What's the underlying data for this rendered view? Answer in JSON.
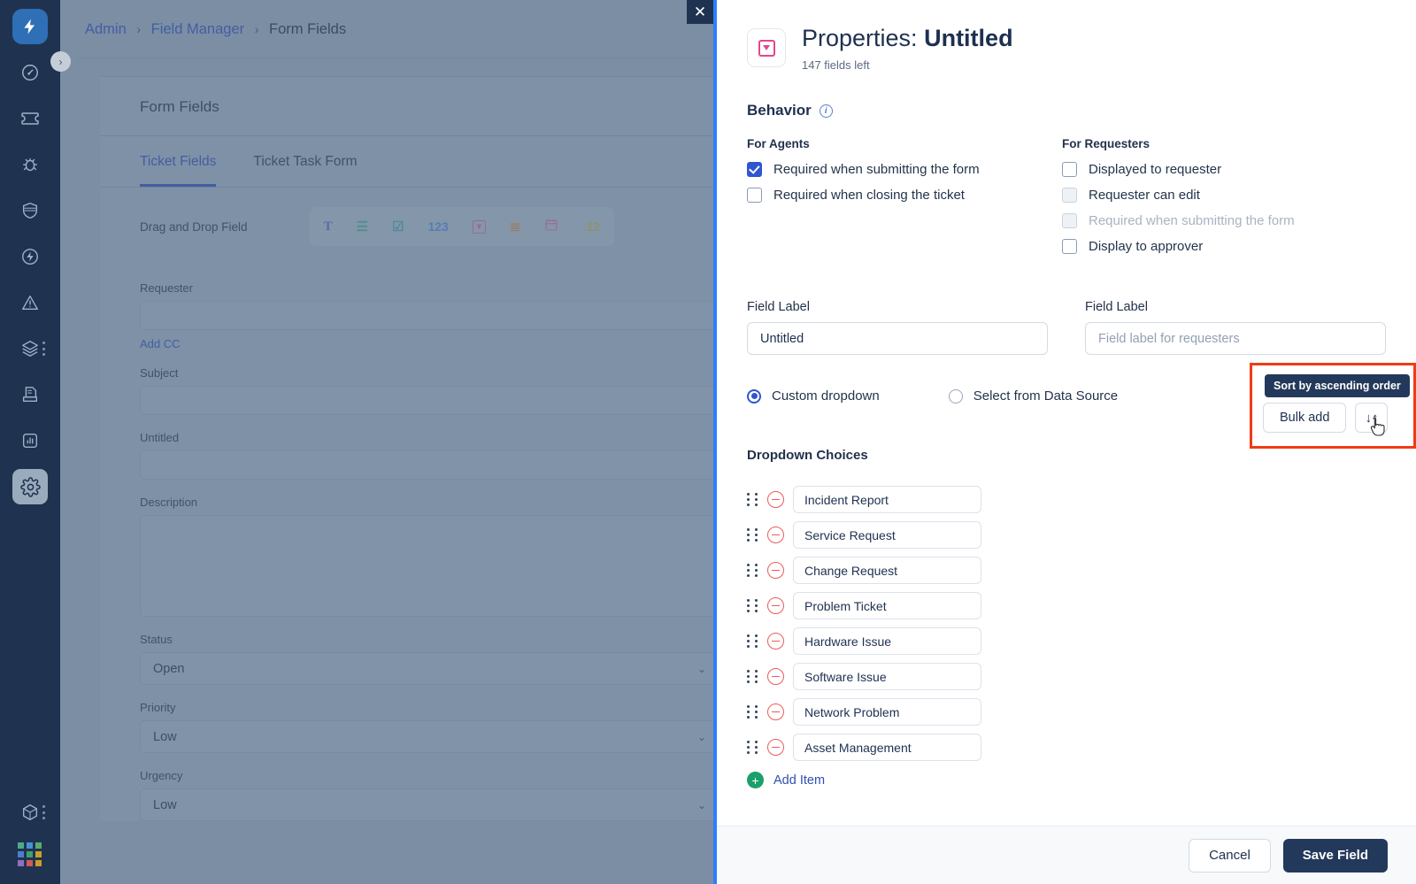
{
  "sidebar": {
    "logo": "lightning-logo",
    "items": [
      {
        "icon": "gauge-icon",
        "name": "dashboard"
      },
      {
        "icon": "ticket-icon",
        "name": "tickets"
      },
      {
        "icon": "bug-icon",
        "name": "problems"
      },
      {
        "icon": "shield-icon",
        "name": "changes"
      },
      {
        "icon": "lightning-circle-icon",
        "name": "releases"
      },
      {
        "icon": "alert-triangle-icon",
        "name": "incidents"
      },
      {
        "icon": "layers-icon",
        "name": "assets"
      },
      {
        "icon": "document-tray-icon",
        "name": "knowledge"
      },
      {
        "icon": "chart-icon",
        "name": "analytics"
      },
      {
        "icon": "gear-icon",
        "name": "admin"
      }
    ],
    "bottom_items": [
      {
        "icon": "cube-icon",
        "name": "marketplace"
      },
      {
        "icon": "apps-grid-icon",
        "name": "apps"
      }
    ],
    "expand_toggle": "›"
  },
  "background": {
    "breadcrumb": {
      "admin": "Admin",
      "field_manager": "Field Manager",
      "current": "Form Fields",
      "separator": "›"
    },
    "card_title": "Form Fields",
    "tabs": [
      {
        "label": "Ticket Fields",
        "active": true
      },
      {
        "label": "Ticket Task Form",
        "active": false
      }
    ],
    "drag_drop_label": "Drag and Drop Field",
    "field_types": [
      {
        "glyph": "T",
        "name": "text-field-icon",
        "color": "#2f4fb0"
      },
      {
        "glyph": "☰",
        "name": "paragraph-field-icon",
        "color": "#2c9e7a"
      },
      {
        "glyph": "☑",
        "name": "checkbox-field-icon",
        "color": "#2a8f9e"
      },
      {
        "glyph": "123",
        "name": "number-field-icon",
        "color": "#3570d4"
      },
      {
        "glyph": "▾",
        "name": "dropdown-field-icon",
        "color": "#d4458a"
      },
      {
        "glyph": "≣",
        "name": "multiselect-field-icon",
        "color": "#d4762a"
      },
      {
        "glyph": "Ὄ5",
        "name": "date-field-icon",
        "color": "#d4458a"
      },
      {
        "glyph": ".12",
        "name": "decimal-field-icon",
        "color": "#c6a02a"
      }
    ],
    "fields": [
      {
        "label": "Requester",
        "type": "input",
        "value": ""
      },
      {
        "label": "Subject",
        "type": "input",
        "value": ""
      },
      {
        "label": "Untitled",
        "type": "input",
        "value": ""
      },
      {
        "label": "Description",
        "type": "textarea",
        "value": ""
      }
    ],
    "add_cc": "Add CC",
    "selects": [
      {
        "label": "Status",
        "value": "Open"
      },
      {
        "label": "Priority",
        "value": "Low"
      },
      {
        "label": "Urgency",
        "value": "Low"
      }
    ],
    "close_icon": "✕"
  },
  "panel": {
    "header": {
      "icon": "dropdown-field-icon",
      "title_prefix": "Properties:",
      "title_value": "Untitled",
      "subtitle": "147 fields left"
    },
    "behavior": {
      "section_title": "Behavior",
      "info_icon": "i",
      "agents": {
        "heading": "For Agents",
        "options": [
          {
            "label": "Required when submitting the form",
            "checked": true,
            "disabled": false
          },
          {
            "label": "Required when closing the ticket",
            "checked": false,
            "disabled": false
          }
        ]
      },
      "requesters": {
        "heading": "For Requesters",
        "options": [
          {
            "label": "Displayed to requester",
            "checked": false,
            "disabled": false
          },
          {
            "label": "Requester can edit",
            "checked": false,
            "disabled": true
          },
          {
            "label": "Required when submitting the form",
            "checked": false,
            "disabled": true
          },
          {
            "label": "Display to approver",
            "checked": false,
            "disabled": false
          }
        ]
      }
    },
    "field_label_agent": {
      "title": "Field Label",
      "value": "Untitled",
      "placeholder": ""
    },
    "field_label_requester": {
      "title": "Field Label",
      "value": "",
      "placeholder": "Field label for requesters"
    },
    "source_options": [
      {
        "label": "Custom dropdown",
        "selected": true
      },
      {
        "label": "Select from Data Source",
        "selected": false
      }
    ],
    "dropdown_choices_heading": "Dropdown Choices",
    "choices": [
      "Incident Report",
      "Service Request",
      "Change Request",
      "Problem Ticket",
      "Hardware Issue",
      "Software Issue",
      "Network Problem",
      "Asset Management"
    ],
    "add_item": {
      "label": "Add Item",
      "icon": "plus-icon"
    },
    "tools": {
      "tooltip": "Sort by ascending order",
      "bulk_add": "Bulk add",
      "sort_icon": "↓↑",
      "highlight_color": "#f03c15"
    },
    "footer": {
      "cancel": "Cancel",
      "save": "Save Field"
    }
  }
}
